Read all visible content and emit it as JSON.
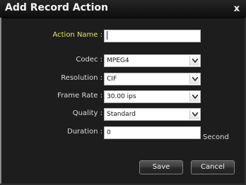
{
  "dialog": {
    "title": "Add Record Action",
    "close_label": "x"
  },
  "fields": {
    "action_name": {
      "label": "Action Name :",
      "value": ""
    },
    "codec": {
      "label": "Codec :",
      "value": "MPEG4"
    },
    "resolution": {
      "label": "Resolution :",
      "value": "CIF"
    },
    "frame_rate": {
      "label": "Frame Rate :",
      "value": "30.00 ips"
    },
    "quality": {
      "label": "Quality :",
      "value": "Standard"
    },
    "duration": {
      "label": "Duration :",
      "value": "0",
      "unit": "Second"
    }
  },
  "buttons": {
    "save": "Save",
    "cancel": "Cancel"
  },
  "icons": {
    "close": "close-icon",
    "dropdown": "chevron-down-icon"
  },
  "colors": {
    "background": "#1d1d1d",
    "title_bar": "#0e0e0e",
    "title_text": "#f4f4f4",
    "label_text": "#dcdcdc",
    "highlight_label": "#dfe85f",
    "input_background": "#ffffff",
    "button_background": "#3b3b3b"
  }
}
